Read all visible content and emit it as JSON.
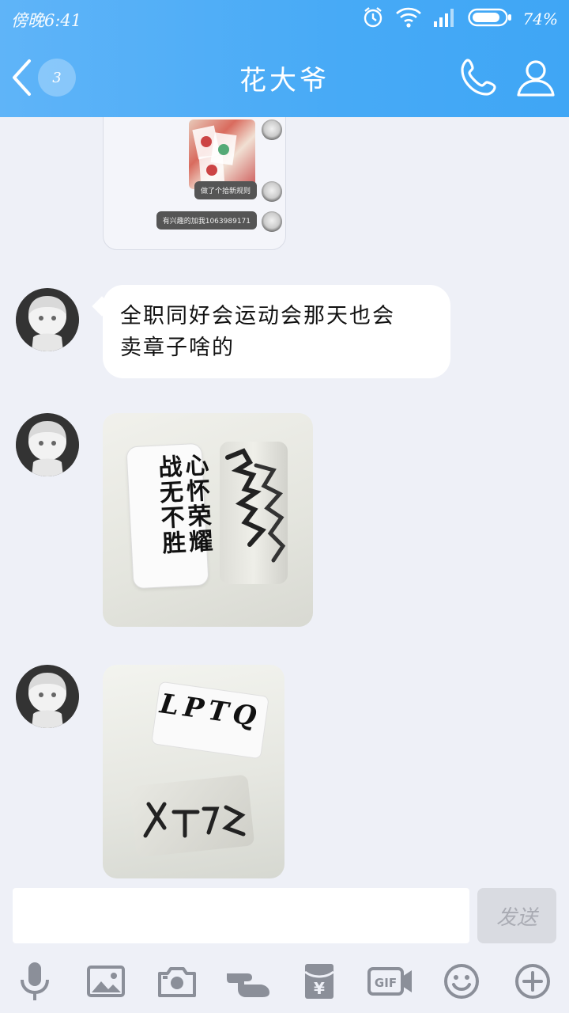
{
  "status_bar": {
    "time": "傍晚6:41",
    "battery": "74%"
  },
  "nav": {
    "unread_count": "3",
    "title": "花大爷"
  },
  "messages": [
    {
      "type": "forwarded-screenshot",
      "lines": [
        "做了个拾新规则",
        "有兴趣的加我1063989171"
      ]
    },
    {
      "type": "text",
      "lines": [
        "全职同好会运动会那天也会",
        "卖章子啥的"
      ]
    },
    {
      "type": "image",
      "caption_lines": [
        "心怀荣耀",
        "战无不胜"
      ]
    },
    {
      "type": "image",
      "caption_lines": [
        "LPTQ"
      ]
    }
  ],
  "input": {
    "value": "",
    "placeholder": ""
  },
  "send_label": "发送",
  "toolbar_icons": [
    "microphone-icon",
    "image-icon",
    "camera-icon",
    "poke-icon",
    "red-packet-icon",
    "gif-icon",
    "emoji-icon",
    "plus-icon"
  ],
  "toolbar": {
    "gif_label": "GIF"
  },
  "colors": {
    "header": "#47aaf6",
    "chat_bg": "#eef0f7",
    "bubble": "#ffffff",
    "send_disabled": "#d9dbe1"
  }
}
